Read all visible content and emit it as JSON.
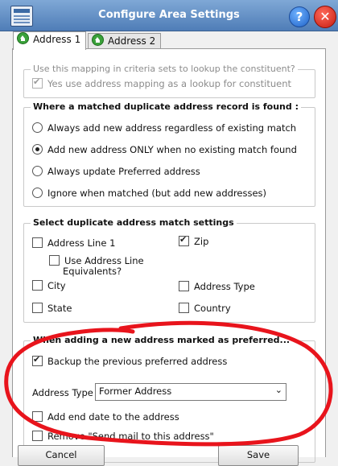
{
  "window": {
    "title": "Configure Area Settings",
    "help_glyph": "?",
    "close_glyph": "✕"
  },
  "tabs": [
    {
      "label": "Address 1",
      "active": true
    },
    {
      "label": "Address 2",
      "active": false
    }
  ],
  "lookup_group": {
    "title": "Use this mapping in criteria sets to lookup the constituent?",
    "checkbox_label": "Yes use address mapping as a lookup for constituent",
    "checked": true,
    "enabled": false
  },
  "duplicate_group": {
    "title": "Where a matched duplicate address record is found :",
    "options": [
      "Always add new address regardless of existing match",
      "Add new address ONLY when no existing match found",
      "Always update Preferred address",
      "Ignore when matched (but add new addresses)"
    ],
    "selected_index": 1
  },
  "match_group": {
    "title": "Select duplicate address match settings",
    "address_line_1": "Address Line 1",
    "use_equivalents_line1": "Use Address Line",
    "use_equivalents_line2": "Equivalents?",
    "zip": "Zip",
    "city": "City",
    "address_type": "Address Type",
    "state": "State",
    "country": "Country",
    "zip_checked": true
  },
  "preferred_group": {
    "title": "When adding a new address marked as preferred...",
    "backup_label": "Backup the previous preferred address",
    "backup_checked": true,
    "address_type_label": "Address Type",
    "address_type_value": "Former Address",
    "add_end_date_label": "Add end date to the address",
    "remove_send_mail_label": "Remove \"Send mail to this address\""
  },
  "footer": {
    "cancel_label": "Cancel",
    "save_label": "Save"
  },
  "colors": {
    "title_bar": "#5b87c0",
    "annotation": "#e8141c",
    "tab_icon": "#3aa13a"
  }
}
